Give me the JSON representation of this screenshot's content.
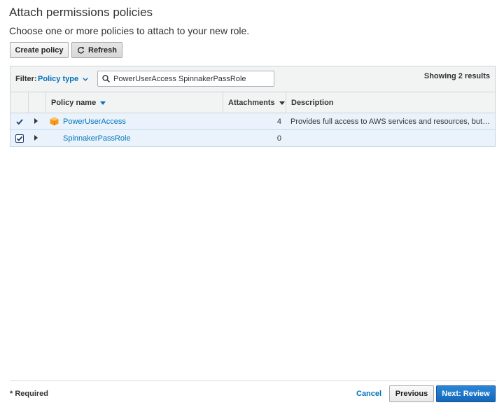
{
  "header": {
    "title": "Attach permissions policies",
    "subtitle": "Choose one or more policies to attach to your new role."
  },
  "actions": {
    "create_label": "Create policy",
    "refresh_label": "Refresh"
  },
  "filter": {
    "label": "Filter:",
    "selected": "Policy type",
    "search_value": "PowerUserAccess SpinnakerPassRole",
    "result_count": "Showing 2 results"
  },
  "table": {
    "columns": {
      "name": "Policy name",
      "attachments": "Attachments",
      "description": "Description"
    },
    "rows": [
      {
        "checked": true,
        "name": "PowerUserAccess",
        "attachments": "4",
        "description": "Provides full access to AWS services and resources, but doe…",
        "icon": "aws-managed-policy-icon"
      },
      {
        "checked": true,
        "name": "SpinnakerPassRole",
        "attachments": "0",
        "description": "",
        "icon": ""
      }
    ]
  },
  "footer": {
    "required_marker": "*",
    "required_text": " Required",
    "cancel_label": "Cancel",
    "previous_label": "Previous",
    "next_label": "Next: Review"
  },
  "colors": {
    "link": "#0073bb",
    "selected_row": "#eaf3fb",
    "primary_button": "#1567b8",
    "policy_icon": "#f7981f"
  }
}
